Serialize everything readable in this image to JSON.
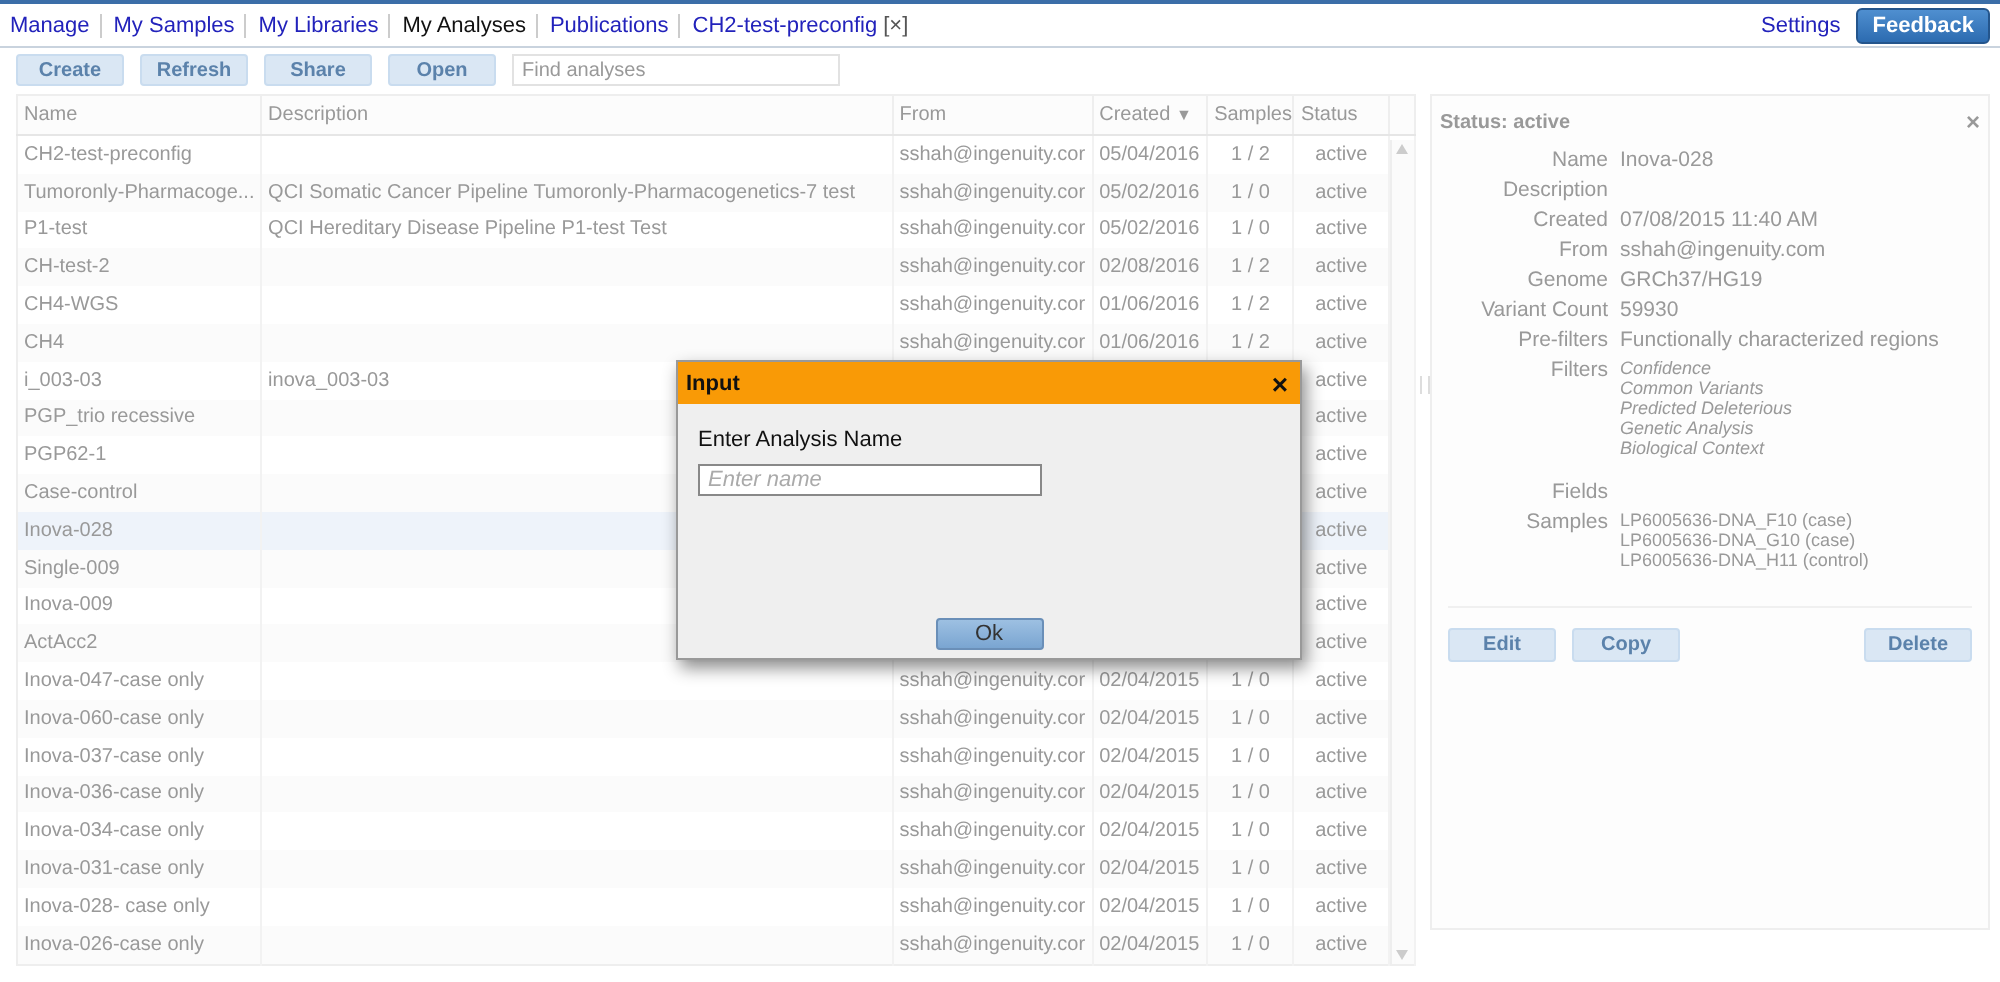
{
  "nav": {
    "tabs": [
      {
        "label": "Manage",
        "selected": false
      },
      {
        "label": "My Samples",
        "selected": false
      },
      {
        "label": "My Libraries",
        "selected": false
      },
      {
        "label": "My Analyses",
        "selected": true
      },
      {
        "label": "Publications",
        "selected": false
      },
      {
        "label": "CH2-test-preconfig",
        "selected": false,
        "close": "[×]"
      }
    ],
    "settings": "Settings",
    "feedback": "Feedback"
  },
  "toolbar": {
    "buttons": [
      "Create",
      "Refresh",
      "Share",
      "Open"
    ],
    "search": {
      "placeholder": "Find analyses"
    }
  },
  "table": {
    "columns": [
      {
        "label": "Name"
      },
      {
        "label": "Description"
      },
      {
        "label": "From"
      },
      {
        "label": "Created",
        "sort_indicator": "▼"
      },
      {
        "label": "Samples"
      },
      {
        "label": "Status"
      }
    ],
    "rows": [
      {
        "name": "CH2-test-preconfig",
        "from": "sshah@ingenuity.cor",
        "created": "05/04/2016",
        "samples": "1 / 2",
        "status": "active",
        "selected": false
      },
      {
        "name": "Tumoronly-Pharmacoge...",
        "description": "QCI Somatic Cancer Pipeline Tumoronly-Pharmacogenetics-7 test",
        "from": "sshah@ingenuity.cor",
        "created": "05/02/2016",
        "samples": "1 / 0",
        "status": "active",
        "selected": false
      },
      {
        "name": "P1-test",
        "description": "QCI Hereditary Disease Pipeline P1-test Test",
        "from": "sshah@ingenuity.cor",
        "created": "05/02/2016",
        "samples": "1 / 0",
        "status": "active",
        "selected": false
      },
      {
        "name": "CH-test-2",
        "from": "sshah@ingenuity.cor",
        "created": "02/08/2016",
        "samples": "1 / 2",
        "status": "active",
        "selected": false
      },
      {
        "name": "CH4-WGS",
        "from": "sshah@ingenuity.cor",
        "created": "01/06/2016",
        "samples": "1 / 2",
        "status": "active",
        "selected": false
      },
      {
        "name": "CH4",
        "from": "sshah@ingenuity.cor",
        "created": "01/06/2016",
        "samples": "1 / 2",
        "status": "active",
        "selected": false
      },
      {
        "name": "i_003-03",
        "description": "inova_003-03",
        "status": "active",
        "selected": false
      },
      {
        "name": "PGP_trio recessive",
        "status": "active",
        "selected": false
      },
      {
        "name": "PGP62-1",
        "status": "active",
        "selected": false
      },
      {
        "name": "Case-control",
        "status": "active",
        "selected": false
      },
      {
        "name": "Inova-028",
        "status": "active",
        "selected": true
      },
      {
        "name": "Single-009",
        "status": "active",
        "selected": false
      },
      {
        "name": "Inova-009",
        "status": "active",
        "selected": false
      },
      {
        "name": "ActAcc2",
        "status": "active",
        "selected": false
      },
      {
        "name": "Inova-047-case only",
        "from": "sshah@ingenuity.cor",
        "created": "02/04/2015",
        "samples": "1 / 0",
        "status": "active",
        "selected": false
      },
      {
        "name": "Inova-060-case only",
        "from": "sshah@ingenuity.cor",
        "created": "02/04/2015",
        "samples": "1 / 0",
        "status": "active",
        "selected": false
      },
      {
        "name": "Inova-037-case only",
        "from": "sshah@ingenuity.cor",
        "created": "02/04/2015",
        "samples": "1 / 0",
        "status": "active",
        "selected": false
      },
      {
        "name": "Inova-036-case only",
        "from": "sshah@ingenuity.cor",
        "created": "02/04/2015",
        "samples": "1 / 0",
        "status": "active",
        "selected": false
      },
      {
        "name": "Inova-034-case only",
        "from": "sshah@ingenuity.cor",
        "created": "02/04/2015",
        "samples": "1 / 0",
        "status": "active",
        "selected": false
      },
      {
        "name": "Inova-031-case only",
        "from": "sshah@ingenuity.cor",
        "created": "02/04/2015",
        "samples": "1 / 0",
        "status": "active",
        "selected": false
      },
      {
        "name": "Inova-028- case only",
        "from": "sshah@ingenuity.cor",
        "created": "02/04/2015",
        "samples": "1 / 0",
        "status": "active",
        "selected": false
      },
      {
        "name": "Inova-026-case only",
        "from": "sshah@ingenuity.cor",
        "created": "02/04/2015",
        "samples": "1 / 0",
        "status": "active",
        "selected": false
      }
    ]
  },
  "details": {
    "title": "Status: active",
    "close": "×",
    "fields": [
      {
        "label": "Name",
        "value": "Inova-028"
      },
      {
        "label": "Description"
      },
      {
        "label": "Created",
        "value": "07/08/2015 11:40 AM"
      },
      {
        "label": "From",
        "value": "sshah@ingenuity.com"
      },
      {
        "label": "Genome",
        "value": "GRCh37/HG19"
      },
      {
        "label": "Variant Count",
        "value": "59930"
      },
      {
        "label": "Pre-filters",
        "value": "Functionally characterized regions"
      },
      {
        "label": "Filters",
        "values": [
          "Confidence",
          "Common Variants",
          "Predicted Deleterious",
          "Genetic Analysis",
          "Biological Context"
        ],
        "italic": true
      },
      {
        "label": "Fields"
      },
      {
        "label": "Samples",
        "values": [
          "LP6005636-DNA_F10 (case)",
          "LP6005636-DNA_G10 (case)",
          "LP6005636-DNA_H11 (control)"
        ],
        "italic": false
      }
    ],
    "buttons": [
      {
        "label": "Edit"
      },
      {
        "label": "Copy"
      },
      {
        "label": "Delete"
      }
    ]
  },
  "dialog": {
    "title": "Input",
    "close": "×",
    "prompt": "Enter Analysis Name",
    "input": {
      "placeholder": "Enter name"
    },
    "ok": "Ok"
  }
}
